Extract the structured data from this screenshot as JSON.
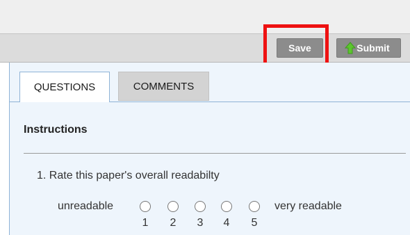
{
  "toolbar": {
    "save_label": "Save",
    "submit_label": "Submit",
    "submit_icon": "green-up-arrow-icon",
    "highlight_color": "#ee1111"
  },
  "tabs": [
    {
      "label": "QUESTIONS",
      "active": true
    },
    {
      "label": "COMMENTS",
      "active": false
    }
  ],
  "instructions": {
    "heading": "Instructions"
  },
  "question": {
    "text": "1. Rate this paper's overall readabilty",
    "low_label": "unreadable",
    "high_label": "very readable",
    "options": [
      "1",
      "2",
      "3",
      "4",
      "5"
    ]
  },
  "colors": {
    "button_bg": "#8c8c8c",
    "content_bg": "#eef5fc",
    "tab_border": "#8fb3d6",
    "inactive_tab_bg": "#d3d3d3"
  }
}
